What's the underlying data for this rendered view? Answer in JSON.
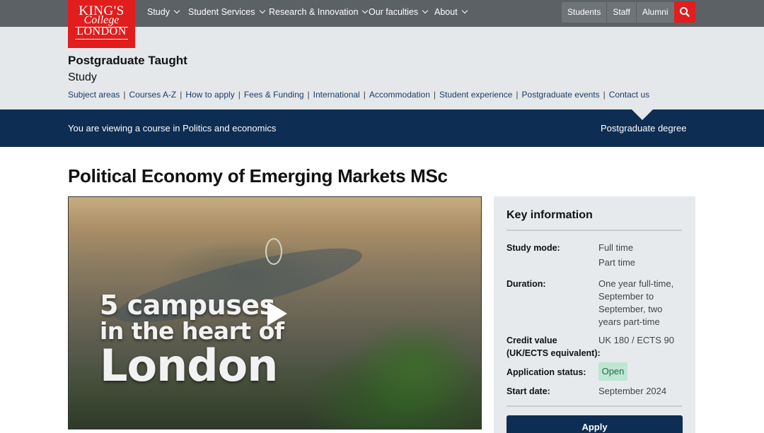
{
  "logo": {
    "line1": "KING'S",
    "line2": "College",
    "line3": "LONDON"
  },
  "topnav": {
    "items": [
      {
        "label": "Study"
      },
      {
        "label": "Student Services"
      },
      {
        "label": "Research & Innovation"
      },
      {
        "label": "Our faculties"
      },
      {
        "label": "About"
      }
    ],
    "audience": [
      "Students",
      "Staff",
      "Alumni"
    ],
    "search_icon": "search-icon"
  },
  "section": {
    "title": "Postgraduate Taught",
    "subtitle": "Study",
    "links": [
      "Subject areas",
      "Courses A-Z",
      "How to apply",
      "Fees & Funding",
      "International",
      "Accommodation",
      "Student experience",
      "Postgraduate events",
      "Contact us"
    ]
  },
  "context_bar": {
    "left": "You are viewing a course in Politics and economics",
    "right": "Postgraduate degree"
  },
  "page_title": "Political Economy of Emerging Markets MSc",
  "video": {
    "line1": "5 campuses",
    "line2": "in the heart of",
    "line3": "London",
    "play_icon": "play-icon"
  },
  "key_info": {
    "title": "Key information",
    "study_mode_label": "Study mode:",
    "study_mode_values": [
      "Full time",
      "Part time"
    ],
    "duration_label": "Duration:",
    "duration_lines": [
      "One year full-time,",
      "September to",
      "September, two",
      "years part-time"
    ],
    "credit_label_lines": [
      "Credit value",
      "(UK/ECTS equivalent):"
    ],
    "credit_value": "UK 180 / ECTS 90",
    "status_label": "Application status:",
    "status_value": "Open",
    "start_label": "Start date:",
    "start_value": "September 2024",
    "apply_label": "Apply"
  },
  "colors": {
    "brand_red": "#e11d1d",
    "navy": "#0d2d52",
    "topbar": "#5c6166",
    "subheader": "#e4e8eb",
    "status_open_bg": "#bfe6d3"
  }
}
